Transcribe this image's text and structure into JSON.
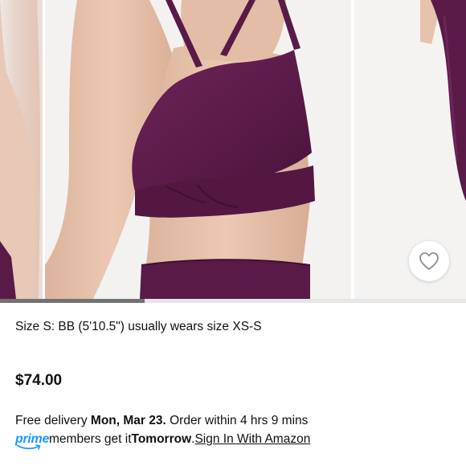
{
  "product": {
    "size_info": "Size S: BB (5'10.5\") usually wears size XS-S",
    "price": "$74.00"
  },
  "delivery": {
    "prefix": "Free delivery ",
    "date": "Mon, Mar 23.",
    "order_within": " Order within 4 hrs 9 mins"
  },
  "prime": {
    "logo_text": "prime",
    "members_text": " members get it ",
    "tomorrow": "Tomorrow",
    "separator": ". ",
    "sign_in_link": "Sign In With Amazon"
  },
  "gallery": {
    "icon": "heart-outline-icon",
    "garment_color": "#5a1a48"
  },
  "colors": {
    "prime_blue": "#1a98ff",
    "text": "#0f1111"
  }
}
